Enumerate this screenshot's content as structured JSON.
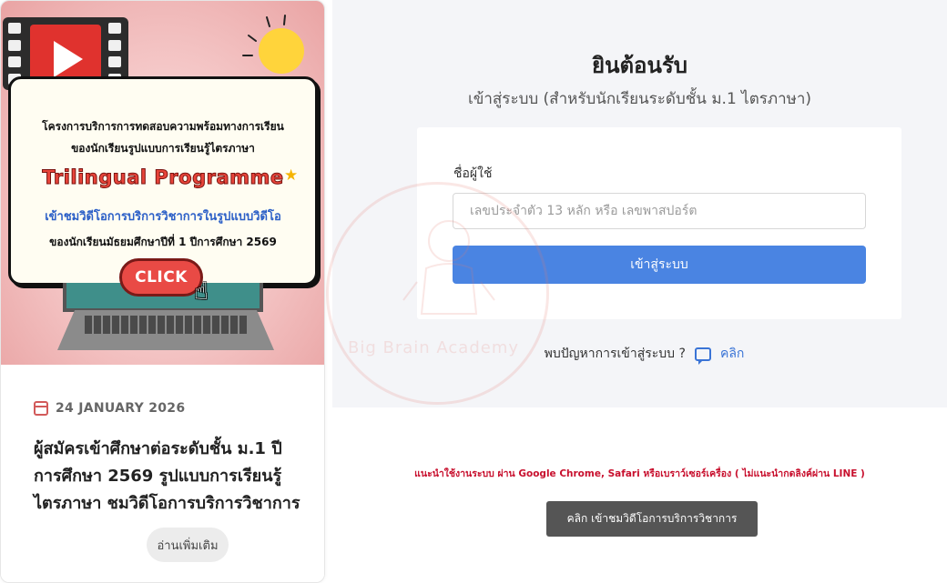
{
  "banner": {
    "line1": "โครงการบริการการทดสอบความพร้อมทางการเรียน",
    "line2": "ของนักเรียนรูปแบบการเรียนรู้ไตรภาษา",
    "programme": "Trilingual Programme",
    "line3": "เข้าชมวิดีโอการบริการวิชาการในรูปแบบวิดีโอ",
    "line4": "ของนักเรียนมัธยมศึกษาปีที่ 1 ปีการศึกษา 2569",
    "click_label": "CLICK"
  },
  "post": {
    "date": "24 JANUARY 2026",
    "title": "ผู้สมัครเข้าศึกษาต่อระดับชั้น ม.1 ปีการศึกษา 2569 รูปแบบการเรียนรู้ไตรภาษา ชมวิดีโอการบริการวิชาการ",
    "read_more": "อ่านเพิ่มเติม"
  },
  "login": {
    "welcome": "ยินต้อนรับ",
    "subtitle": "เข้าสู่ระบบ (สำหรับนักเรียนระดับชั้น ม.1 ไตรภาษา)",
    "username_label": "ชื่อผู้ใช้",
    "username_placeholder": "เลขประจำตัว 13 หลัก หรือ เลขพาสปอร์ต",
    "username_value": "",
    "submit_label": "เข้าสู่ระบบ",
    "help_text": "พบปัญหาการเข้าสู่ระบบ ?",
    "help_link": "คลิก"
  },
  "watermark": {
    "text": "Big Brain Academy"
  },
  "footer": {
    "recommendation": "แนะนำใช้งานระบบ ผ่าน Google Chrome, Safari หรือเบราว์เซอร์เครื่อง ( ไม่แนะนำกดลิงค์ผ่าน LINE )",
    "access_button": "คลิก เข้าชมวิดีโอการบริการวิชาการ"
  },
  "colors": {
    "primary_button": "#4a84e2",
    "warning_text": "#c8102e",
    "dark_button": "#555555",
    "banner_red": "#e94a45"
  }
}
